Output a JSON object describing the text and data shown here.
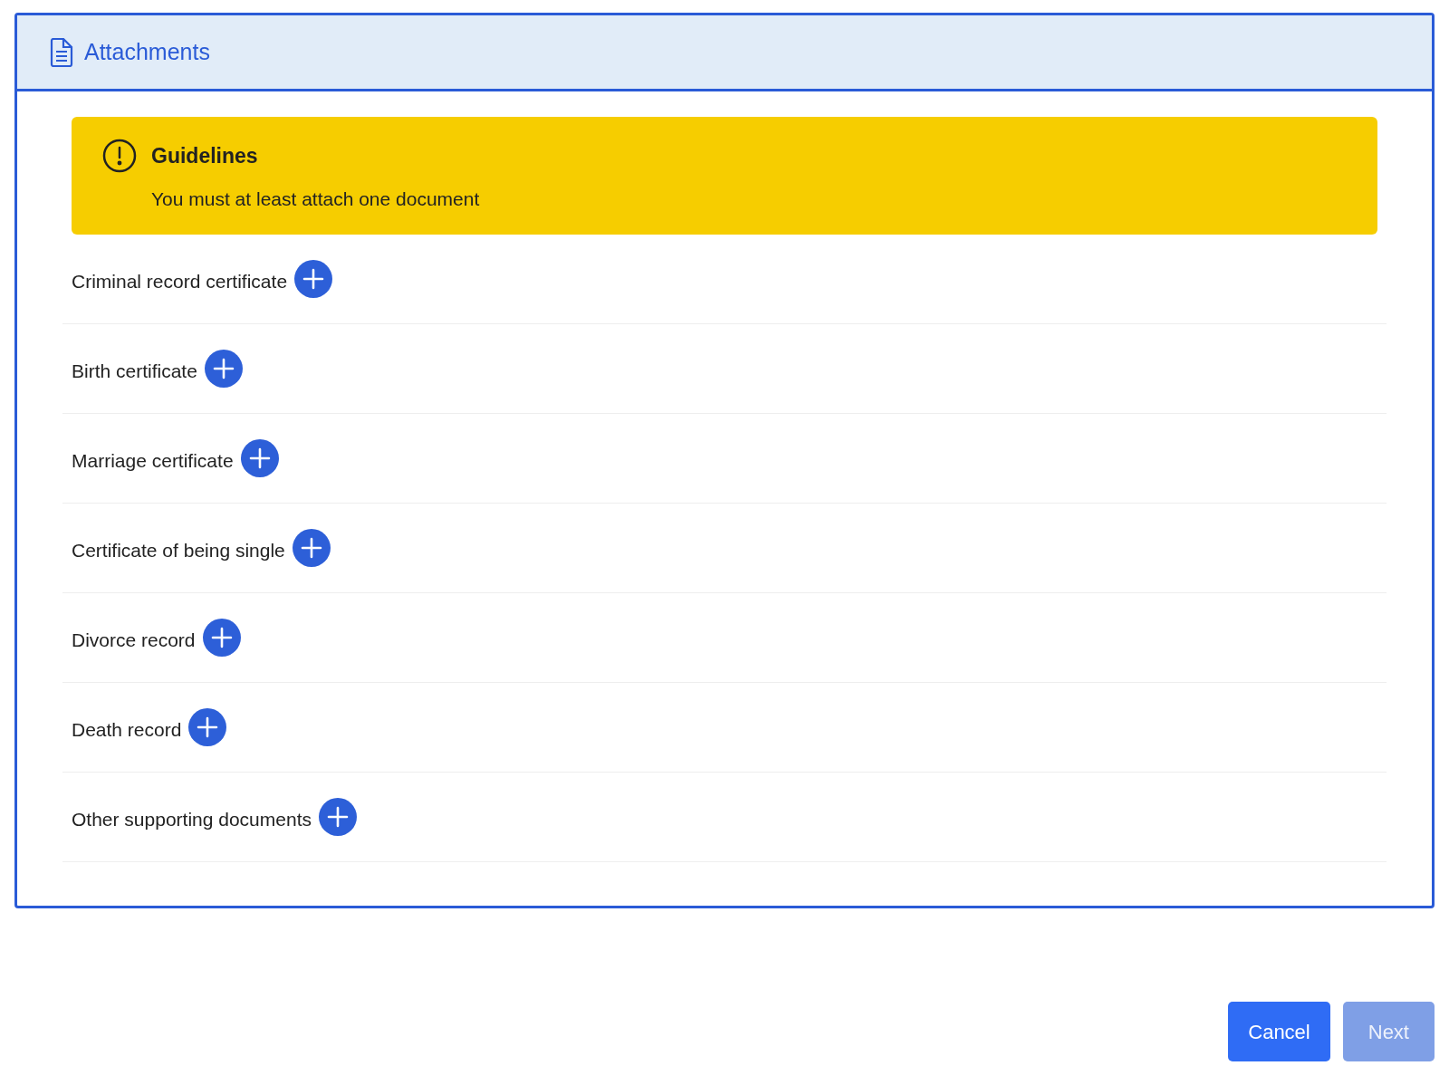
{
  "panel": {
    "title": "Attachments"
  },
  "guidelines": {
    "title": "Guidelines",
    "text": "You must at least attach one document"
  },
  "documents": [
    {
      "label": "Criminal record certificate"
    },
    {
      "label": "Birth certificate"
    },
    {
      "label": "Marriage certificate"
    },
    {
      "label": "Certificate of being single"
    },
    {
      "label": "Divorce record"
    },
    {
      "label": "Death record"
    },
    {
      "label": "Other supporting documents"
    }
  ],
  "buttons": [
    {
      "label": "Cancel",
      "disabled": false
    },
    {
      "label": "Next",
      "disabled": true
    }
  ]
}
